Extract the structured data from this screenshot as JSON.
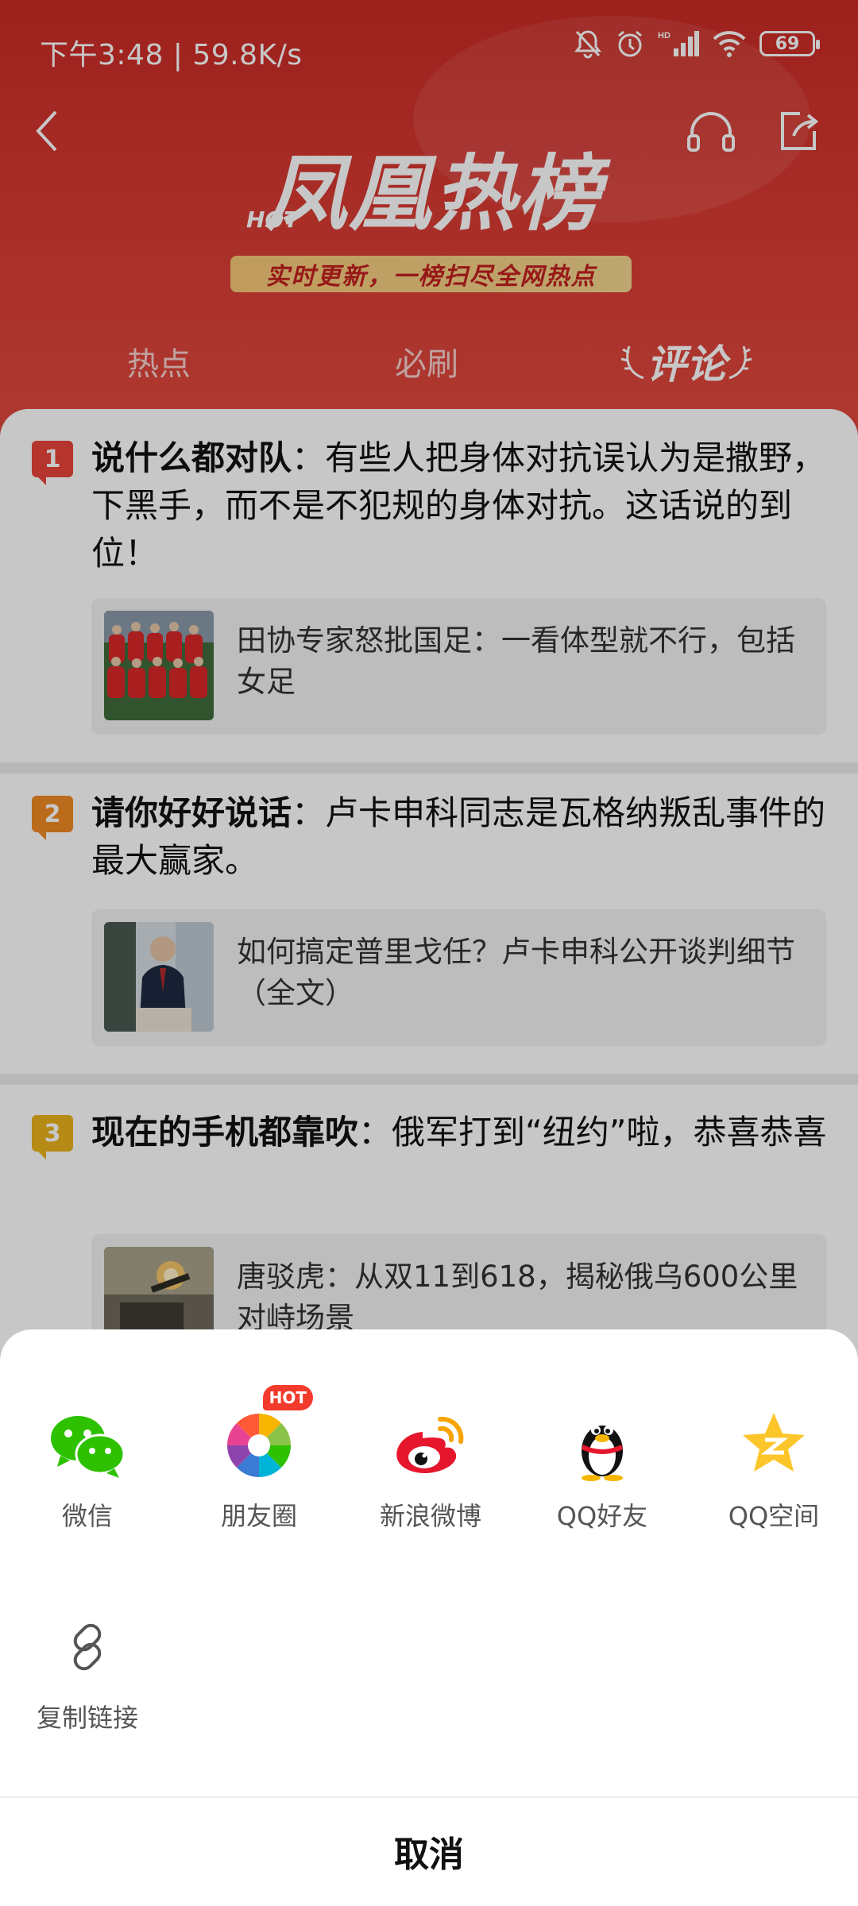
{
  "status_bar": {
    "time": "下午3:48 | 59.8K/s",
    "battery": "69"
  },
  "header": {
    "brand_hot": "HOT",
    "brand_title": "凤凰热榜",
    "slogan": "实时更新，一榜扫尽全网热点"
  },
  "tabs": [
    {
      "label": "热点"
    },
    {
      "label": "必刷"
    },
    {
      "label": "评论"
    }
  ],
  "items": [
    {
      "rank": "1",
      "author": "说什么都对队",
      "comment": "：有些人把身体对抗误认为是撒野，下黑手，而不是不犯规的身体对抗。这话说的到位！",
      "news": "田协专家怒批国足：一看体型就不行，包括女足"
    },
    {
      "rank": "2",
      "author": "请你好好说话",
      "comment": "：卢卡申科同志是瓦格纳叛乱事件的最大赢家。",
      "news": "如何搞定普里戈任？卢卡申科公开谈判细节（全文）"
    },
    {
      "rank": "3",
      "author": "现在的手机都靠吹",
      "comment": "：俄军打到“纽约”啦，恭喜恭喜",
      "news": "唐驳虎：从双11到618，揭秘俄乌600公里对峙场景"
    }
  ],
  "share_sheet": {
    "options": [
      {
        "label": "微信"
      },
      {
        "label": "朋友圈",
        "badge": "HOT"
      },
      {
        "label": "新浪微博"
      },
      {
        "label": "QQ好友"
      },
      {
        "label": "QQ空间"
      },
      {
        "label": "复制链接"
      }
    ],
    "cancel": "取消"
  },
  "colors": {
    "header_red": "#d83a33",
    "rank1": "#e8453c",
    "rank2": "#f08a24",
    "rank3": "#e9b21c",
    "wechat_green": "#2dc100"
  }
}
